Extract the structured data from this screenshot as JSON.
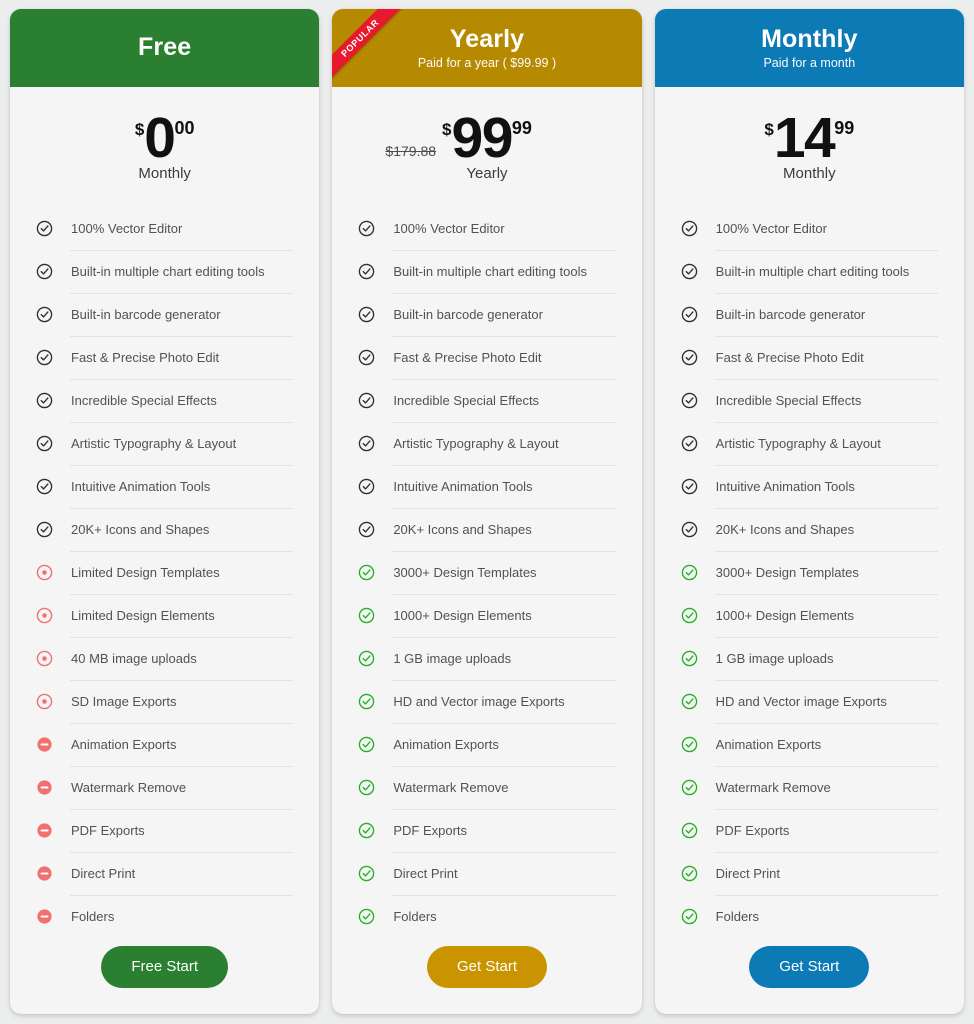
{
  "theme": {
    "page_background": "#eceded",
    "card_background": "#f5f5f5",
    "green": "#2a8030",
    "gold": "#b58900",
    "blue": "#0c7ab5",
    "ribbon_red": "#e8192c",
    "icon_dark": "#2e2e2e",
    "icon_green": "#21b121",
    "icon_red_light": "#f26f6f",
    "icon_red_solid": "#f2706f",
    "text_color": "#525252",
    "divider": "#e2e2e2"
  },
  "plans": [
    {
      "id": "free",
      "accent": "green",
      "title": "Free",
      "subtitle": "",
      "ribbon": "",
      "old_price": "",
      "currency": "$",
      "amount": "0",
      "cents": "00",
      "period": "Monthly",
      "cta_label": "Free Start",
      "features": [
        {
          "label": "100% Vector Editor",
          "icon": "check-circle-dark"
        },
        {
          "label": "Built-in multiple chart editing tools",
          "icon": "check-circle-dark"
        },
        {
          "label": "Built-in barcode generator",
          "icon": "check-circle-dark"
        },
        {
          "label": "Fast & Precise Photo Edit",
          "icon": "check-circle-dark"
        },
        {
          "label": "Incredible Special Effects",
          "icon": "check-circle-dark"
        },
        {
          "label": "Artistic Typography & Layout",
          "icon": "check-circle-dark"
        },
        {
          "label": "Intuitive Animation Tools",
          "icon": "check-circle-dark"
        },
        {
          "label": "20K+ Icons and Shapes",
          "icon": "check-circle-dark"
        },
        {
          "label": "Limited Design Templates",
          "icon": "dot-circle-red"
        },
        {
          "label": "Limited Design Elements",
          "icon": "dot-circle-red"
        },
        {
          "label": "40 MB image uploads",
          "icon": "dot-circle-red"
        },
        {
          "label": "SD Image Exports",
          "icon": "dot-circle-red"
        },
        {
          "label": "Animation Exports",
          "icon": "minus-circle-red"
        },
        {
          "label": "Watermark Remove",
          "icon": "minus-circle-red"
        },
        {
          "label": "PDF Exports",
          "icon": "minus-circle-red"
        },
        {
          "label": "Direct Print",
          "icon": "minus-circle-red"
        },
        {
          "label": "Folders",
          "icon": "minus-circle-red"
        }
      ]
    },
    {
      "id": "yearly",
      "accent": "gold",
      "title": "Yearly",
      "subtitle": "Paid for a year ( $99.99 )",
      "ribbon": "POPULAR",
      "old_price": "$179.88",
      "currency": "$",
      "amount": "99",
      "cents": "99",
      "period": "Yearly",
      "cta_label": "Get Start",
      "features": [
        {
          "label": "100% Vector Editor",
          "icon": "check-circle-dark"
        },
        {
          "label": "Built-in multiple chart editing tools",
          "icon": "check-circle-dark"
        },
        {
          "label": "Built-in barcode generator",
          "icon": "check-circle-dark"
        },
        {
          "label": "Fast & Precise Photo Edit",
          "icon": "check-circle-dark"
        },
        {
          "label": "Incredible Special Effects",
          "icon": "check-circle-dark"
        },
        {
          "label": "Artistic Typography & Layout",
          "icon": "check-circle-dark"
        },
        {
          "label": "Intuitive Animation Tools",
          "icon": "check-circle-dark"
        },
        {
          "label": "20K+ Icons and Shapes",
          "icon": "check-circle-dark"
        },
        {
          "label": "3000+ Design Templates",
          "icon": "check-circle-green"
        },
        {
          "label": "1000+ Design Elements",
          "icon": "check-circle-green"
        },
        {
          "label": "1 GB image uploads",
          "icon": "check-circle-green"
        },
        {
          "label": "HD and Vector image Exports",
          "icon": "check-circle-green"
        },
        {
          "label": "Animation Exports",
          "icon": "check-circle-green"
        },
        {
          "label": "Watermark Remove",
          "icon": "check-circle-green"
        },
        {
          "label": "PDF Exports",
          "icon": "check-circle-green"
        },
        {
          "label": "Direct Print",
          "icon": "check-circle-green"
        },
        {
          "label": "Folders",
          "icon": "check-circle-green"
        }
      ]
    },
    {
      "id": "monthly",
      "accent": "blue",
      "title": "Monthly",
      "subtitle": "Paid for a month",
      "ribbon": "",
      "old_price": "",
      "currency": "$",
      "amount": "14",
      "cents": "99",
      "period": "Monthly",
      "cta_label": "Get Start",
      "features": [
        {
          "label": "100% Vector Editor",
          "icon": "check-circle-dark"
        },
        {
          "label": "Built-in multiple chart editing tools",
          "icon": "check-circle-dark"
        },
        {
          "label": "Built-in barcode generator",
          "icon": "check-circle-dark"
        },
        {
          "label": "Fast & Precise Photo Edit",
          "icon": "check-circle-dark"
        },
        {
          "label": "Incredible Special Effects",
          "icon": "check-circle-dark"
        },
        {
          "label": "Artistic Typography & Layout",
          "icon": "check-circle-dark"
        },
        {
          "label": "Intuitive Animation Tools",
          "icon": "check-circle-dark"
        },
        {
          "label": "20K+ Icons and Shapes",
          "icon": "check-circle-dark"
        },
        {
          "label": "3000+ Design Templates",
          "icon": "check-circle-green"
        },
        {
          "label": "1000+ Design Elements",
          "icon": "check-circle-green"
        },
        {
          "label": "1 GB image uploads",
          "icon": "check-circle-green"
        },
        {
          "label": "HD and Vector image Exports",
          "icon": "check-circle-green"
        },
        {
          "label": "Animation Exports",
          "icon": "check-circle-green"
        },
        {
          "label": "Watermark Remove",
          "icon": "check-circle-green"
        },
        {
          "label": "PDF Exports",
          "icon": "check-circle-green"
        },
        {
          "label": "Direct Print",
          "icon": "check-circle-green"
        },
        {
          "label": "Folders",
          "icon": "check-circle-green"
        }
      ]
    }
  ]
}
